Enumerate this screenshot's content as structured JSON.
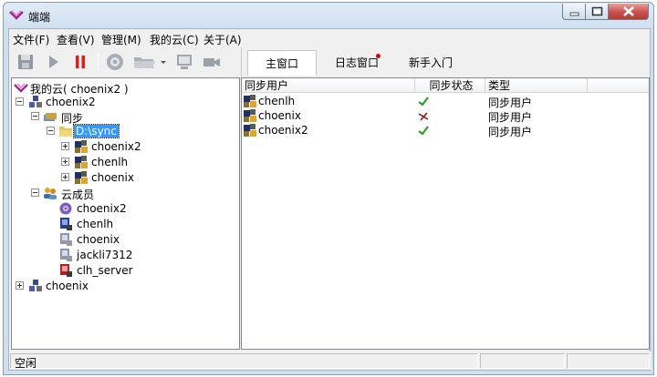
{
  "window": {
    "title": "端端"
  },
  "menu": [
    "文件(F)",
    "查看(V)",
    "管理(M)",
    "我的云(C)",
    "关于(A)"
  ],
  "toolbar": {
    "icons": [
      "save-icon",
      "play-icon",
      "pause-icon",
      "sync-icon",
      "folder-open-icon",
      "dropdown-arrow-icon",
      "monitor-icon",
      "video-icon"
    ]
  },
  "tabs": [
    {
      "label": "主窗口",
      "active": true
    },
    {
      "label": "日志窗口",
      "notify": true
    },
    {
      "label": "新手入门"
    }
  ],
  "tree": {
    "root": "我的云( choenix2 )",
    "host1": "choenix2",
    "sync_group": "同步",
    "sync_folder": "D:\\sync",
    "sync_users": [
      "choenix2",
      "chenlh",
      "choenix"
    ],
    "members_group": "云成员",
    "members": [
      "choenix2",
      "chenlh",
      "choenix",
      "jackli7312",
      "clh_server"
    ],
    "host2": "choenix"
  },
  "list": {
    "columns": [
      "同步用户",
      "同步状态",
      "类型"
    ],
    "rows": [
      {
        "user": "chenlh",
        "status": "ok",
        "type": "同步用户"
      },
      {
        "user": "choenix",
        "status": "error",
        "type": "同步用户"
      },
      {
        "user": "choenix2",
        "status": "ok",
        "type": "同步用户"
      }
    ]
  },
  "status": {
    "text": "空闲"
  },
  "colors": {
    "selection": "#3399ff",
    "ok": "#2ca02c",
    "error": "#c00000",
    "notify_dot": "#e00000"
  }
}
